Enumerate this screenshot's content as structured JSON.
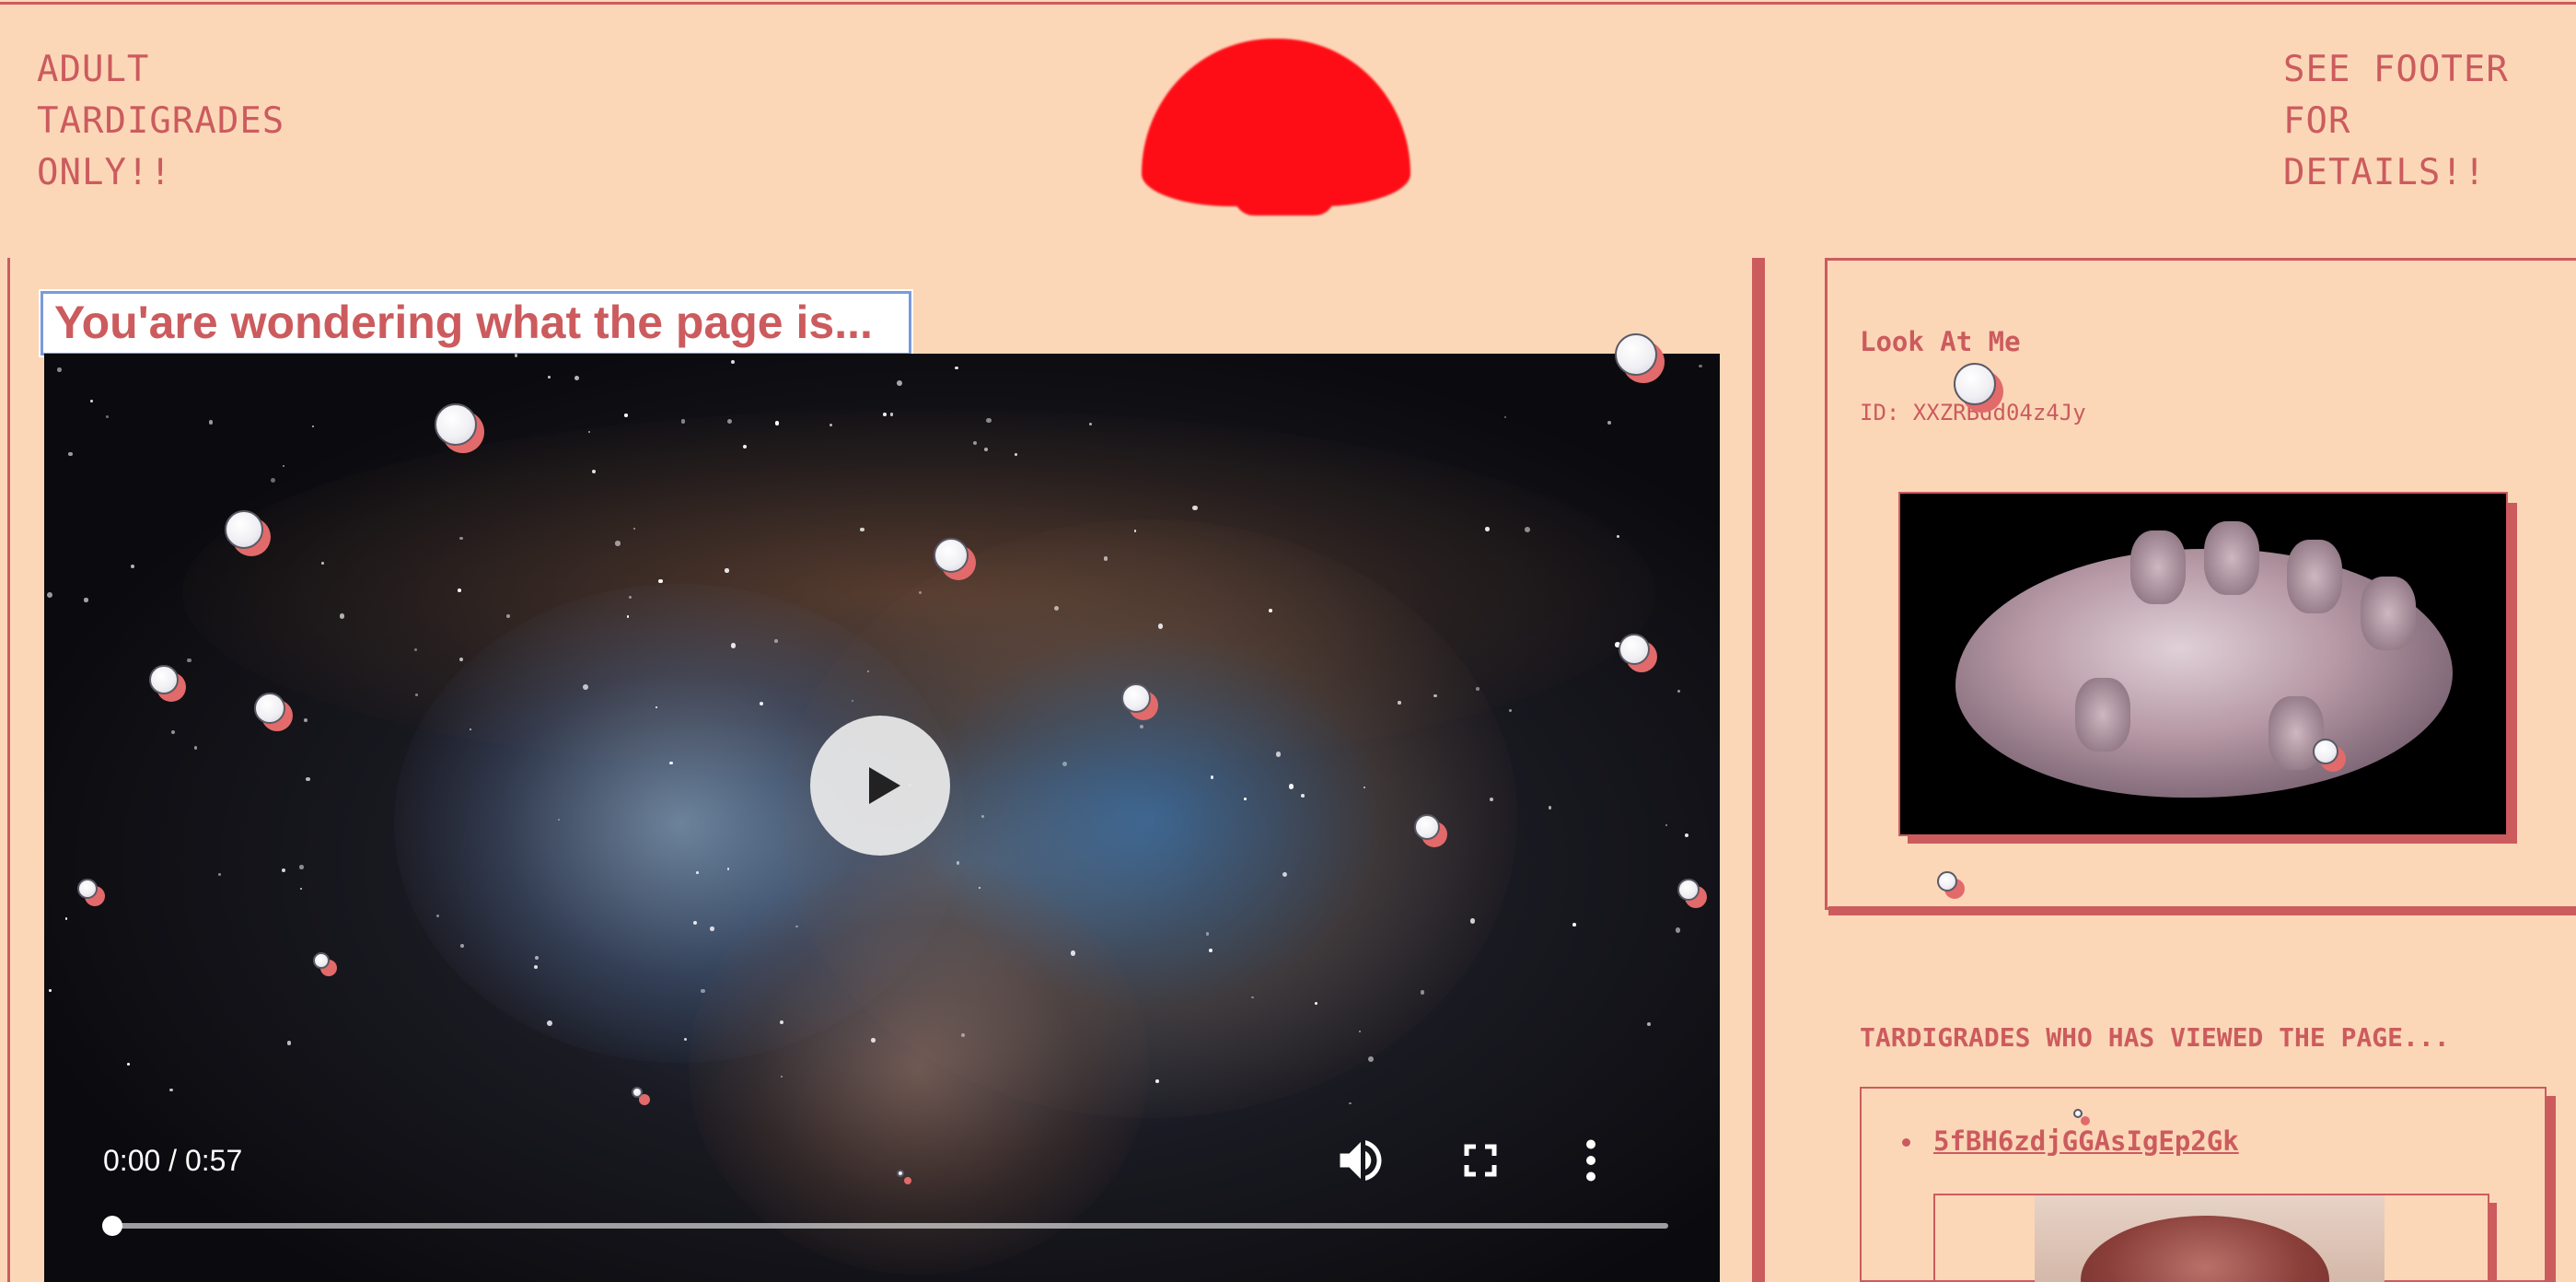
{
  "header": {
    "left_text": "ADULT\nTARDIGRADES\nONLY!!",
    "right_text": "SEE FOOTER\nFOR DETAILS!!"
  },
  "main": {
    "heading": "You'are wondering what the page is...",
    "video": {
      "time": "0:00 / 0:57",
      "progress": 0.0,
      "icons": [
        "play-icon",
        "volume-icon",
        "fullscreen-icon",
        "more-options-icon"
      ]
    }
  },
  "sidebar": {
    "card": {
      "title": "Look At Me",
      "id_text": "ID: XXZRBdd04z4Jy",
      "image": "tardigrade-image"
    },
    "viewers": {
      "heading": "TARDIGRADES WHO HAS VIEWED THE PAGE...",
      "items": [
        {
          "label": "5fBH6zdjGGAsIgEp2Gk"
        }
      ]
    }
  },
  "colors": {
    "background": "#fbd7b8",
    "accent": "#cc5b5e",
    "sun": "#ff0d16"
  }
}
